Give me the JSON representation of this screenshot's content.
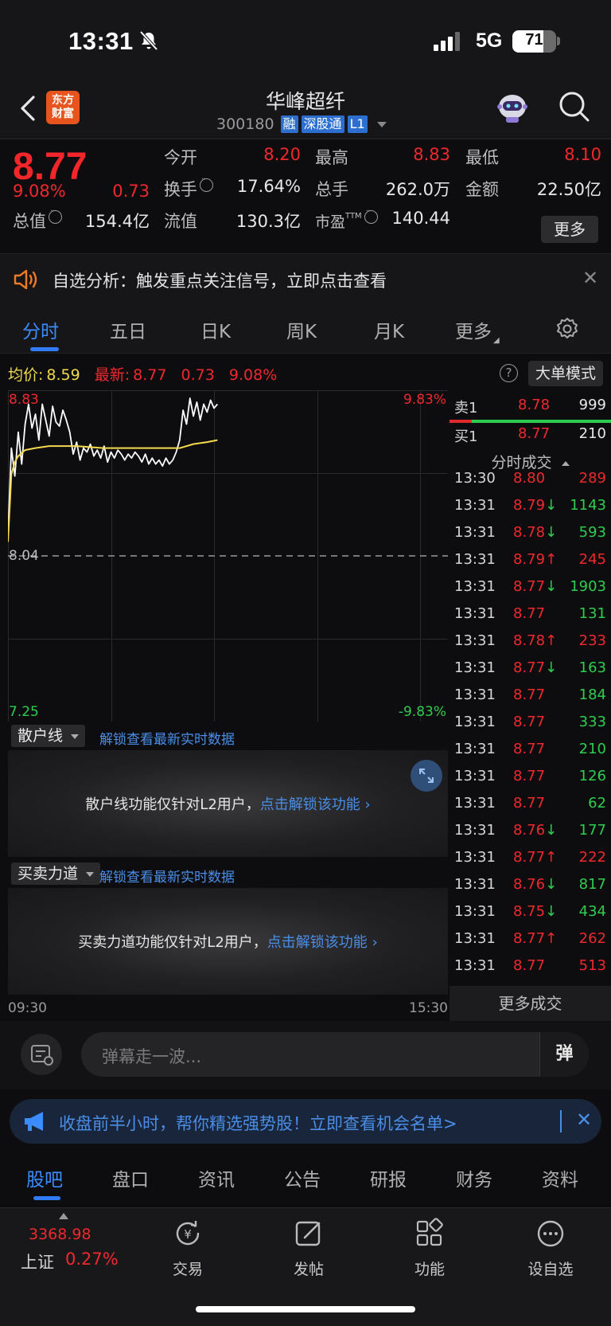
{
  "status_bar": {
    "time": "13:31",
    "network": "5G",
    "battery": "71",
    "battery_level": 0.71
  },
  "header": {
    "logo_text": "东方财富",
    "stock_name": "华峰超纤",
    "stock_code": "300180",
    "tags": [
      "融",
      "深股通",
      "L1"
    ]
  },
  "quote": {
    "price": "8.77",
    "change_pct": "9.08%",
    "change": "0.73",
    "open_label": "今开",
    "open": "8.20",
    "high_label": "最高",
    "high": "8.83",
    "low_label": "最低",
    "low": "8.10",
    "turnover_label": "换手",
    "turnover": "17.64%",
    "volume_label": "总手",
    "volume": "262.0万",
    "amount_label": "金额",
    "amount": "22.50亿",
    "mktcap_label": "总值",
    "mktcap": "154.4亿",
    "float_label": "流值",
    "float_cap": "130.3亿",
    "pe_label": "市盈",
    "pe_sup": "TTM",
    "pe": "140.44",
    "more_button": "更多"
  },
  "banner": {
    "text": "自选分析：触发重点关注信号，立即点击查看"
  },
  "tabs": [
    {
      "label": "分时",
      "active": true
    },
    {
      "label": "五日"
    },
    {
      "label": "日K"
    },
    {
      "label": "周K"
    },
    {
      "label": "月K"
    },
    {
      "label": "更多"
    }
  ],
  "chart_header": {
    "avg_label": "均价:",
    "avg": "8.59",
    "latest_label": "最新:",
    "latest": "8.77",
    "change": "0.73",
    "change_pct": "9.08%",
    "big_order_button": "大单模式"
  },
  "chart_data": {
    "type": "line",
    "title": "",
    "ylim": [
      7.25,
      8.83
    ],
    "y_tick_labels": [
      "8.83",
      "8.04",
      "7.25"
    ],
    "right_tick_labels": [
      "9.83%",
      "-9.83%"
    ],
    "x_tick_labels": [
      "09:30",
      "15:30"
    ],
    "reference_price": 8.04,
    "series": [
      {
        "name": "",
        "color": "#ffffff",
        "x": [
          0,
          1,
          2,
          3,
          4,
          5,
          6,
          7,
          8,
          9,
          10,
          11,
          12,
          13,
          14,
          15,
          16,
          17,
          18,
          19,
          20,
          21,
          22,
          23,
          24,
          25,
          26,
          27,
          28,
          29,
          30,
          31,
          32,
          33,
          34,
          35,
          36,
          37,
          38,
          39,
          40,
          41,
          42,
          43,
          44,
          45,
          46,
          47,
          48,
          49,
          50,
          51,
          52,
          53,
          54,
          55,
          56,
          57,
          58,
          59,
          60,
          61
        ],
        "y": [
          8.15,
          8.58,
          8.44,
          8.66,
          8.5,
          8.7,
          8.8,
          8.68,
          8.75,
          8.62,
          8.8,
          8.72,
          8.64,
          8.79,
          8.71,
          8.69,
          8.77,
          8.72,
          8.66,
          8.55,
          8.61,
          8.52,
          8.58,
          8.56,
          8.6,
          8.54,
          8.57,
          8.53,
          8.59,
          8.51,
          8.56,
          8.53,
          8.57,
          8.55,
          8.52,
          8.55,
          8.53,
          8.56,
          8.54,
          8.51,
          8.55,
          8.5,
          8.53,
          8.5,
          8.52,
          8.49,
          8.53,
          8.5,
          8.52,
          8.56,
          8.62,
          8.77,
          8.7,
          8.83,
          8.74,
          8.81,
          8.72,
          8.8,
          8.76,
          8.82,
          8.78,
          8.8
        ]
      },
      {
        "name": "",
        "color": "#f2d94e",
        "x": [
          0,
          1,
          2,
          3,
          5,
          8,
          12,
          16,
          20,
          28,
          36,
          44,
          50,
          54,
          58,
          61
        ],
        "y": [
          8.11,
          8.45,
          8.51,
          8.54,
          8.57,
          8.58,
          8.59,
          8.59,
          8.59,
          8.58,
          8.58,
          8.58,
          8.58,
          8.6,
          8.61,
          8.62
        ]
      }
    ]
  },
  "panels": [
    {
      "selector": "散户线",
      "link": "解锁查看最新实时数据",
      "msg": "散户线功能仅针对L2用户，",
      "msg_link": "点击解锁该功能"
    },
    {
      "selector": "买卖力道",
      "link": "解锁查看最新实时数据",
      "msg": "买卖力道功能仅针对L2用户，",
      "msg_link": "点击解锁该功能"
    }
  ],
  "order_book": {
    "sell": {
      "label": "卖1",
      "price": "8.78",
      "vol": "999"
    },
    "buy": {
      "label": "买1",
      "price": "8.77",
      "vol": "210"
    }
  },
  "ticks_header": "分时成交",
  "ticks": [
    {
      "t": "13:30",
      "p": "8.80",
      "v": "289",
      "dir": "",
      "vc": "red"
    },
    {
      "t": "13:31",
      "p": "8.79",
      "v": "1143",
      "dir": "↓",
      "vc": "green"
    },
    {
      "t": "13:31",
      "p": "8.78",
      "v": "593",
      "dir": "↓",
      "vc": "green"
    },
    {
      "t": "13:31",
      "p": "8.79",
      "v": "245",
      "dir": "↑",
      "vc": "red"
    },
    {
      "t": "13:31",
      "p": "8.77",
      "v": "1903",
      "dir": "↓",
      "vc": "green"
    },
    {
      "t": "13:31",
      "p": "8.77",
      "v": "131",
      "dir": "",
      "vc": "green"
    },
    {
      "t": "13:31",
      "p": "8.78",
      "v": "233",
      "dir": "↑",
      "vc": "red"
    },
    {
      "t": "13:31",
      "p": "8.77",
      "v": "163",
      "dir": "↓",
      "vc": "green"
    },
    {
      "t": "13:31",
      "p": "8.77",
      "v": "184",
      "dir": "",
      "vc": "green"
    },
    {
      "t": "13:31",
      "p": "8.77",
      "v": "333",
      "dir": "",
      "vc": "green"
    },
    {
      "t": "13:31",
      "p": "8.77",
      "v": "210",
      "dir": "",
      "vc": "green"
    },
    {
      "t": "13:31",
      "p": "8.77",
      "v": "126",
      "dir": "",
      "vc": "green"
    },
    {
      "t": "13:31",
      "p": "8.77",
      "v": "62",
      "dir": "",
      "vc": "green"
    },
    {
      "t": "13:31",
      "p": "8.76",
      "v": "177",
      "dir": "↓",
      "vc": "green"
    },
    {
      "t": "13:31",
      "p": "8.77",
      "v": "222",
      "dir": "↑",
      "vc": "red"
    },
    {
      "t": "13:31",
      "p": "8.76",
      "v": "817",
      "dir": "↓",
      "vc": "green"
    },
    {
      "t": "13:31",
      "p": "8.75",
      "v": "434",
      "dir": "↓",
      "vc": "green"
    },
    {
      "t": "13:31",
      "p": "8.77",
      "v": "262",
      "dir": "↑",
      "vc": "red"
    },
    {
      "t": "13:31",
      "p": "8.77",
      "v": "513",
      "dir": "",
      "vc": "red"
    }
  ],
  "more_trades": "更多成交",
  "comment": {
    "placeholder": "弹幕走一波...",
    "button": "弹"
  },
  "promo": {
    "text": "收盘前半小时，帮你精选强势股！立即查看机会名单>"
  },
  "section_tabs": [
    "股吧",
    "盘口",
    "资讯",
    "公告",
    "研报",
    "财务",
    "资料"
  ],
  "bottom_bar": {
    "index_value": "3368.98",
    "index_name": "上证",
    "index_pct": "0.27%",
    "items": [
      {
        "label": "交易",
        "icon": "trade-icon"
      },
      {
        "label": "发帖",
        "icon": "post-icon"
      },
      {
        "label": "功能",
        "icon": "apps-icon"
      },
      {
        "label": "设自选",
        "icon": "add-watch-icon"
      }
    ]
  },
  "colors": {
    "up": "#f0282d",
    "down": "#2fcd4f",
    "accent": "#3b8cff"
  }
}
